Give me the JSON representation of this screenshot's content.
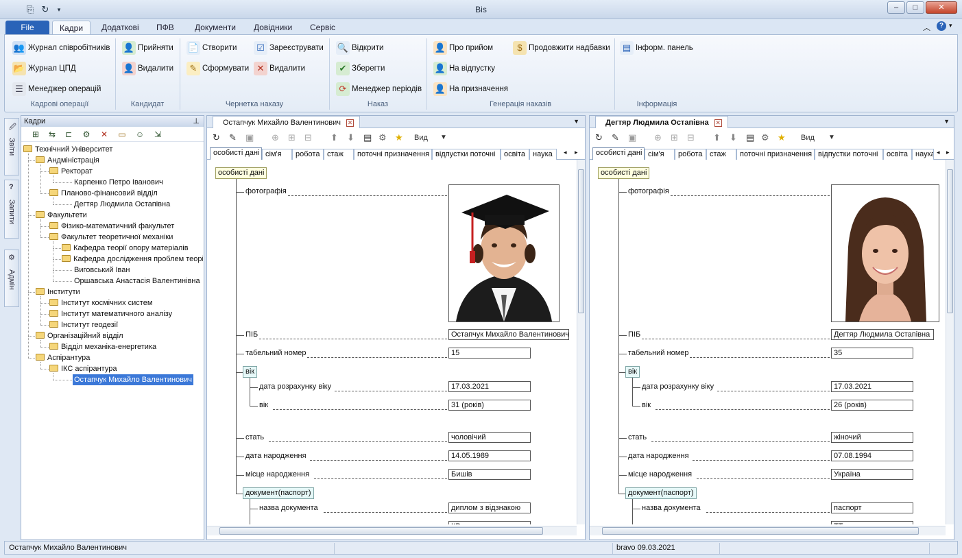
{
  "window": {
    "title": "Bis"
  },
  "menu": {
    "file": "File",
    "tabs": [
      "Кадри",
      "Додаткові",
      "ПФВ",
      "Документи",
      "Довідники",
      "Сервіс"
    ]
  },
  "ribbon": {
    "groups": [
      {
        "label": "Кадрові операції",
        "buttons": [
          "Журнал співробітників",
          "Журнал ЦПД",
          "Менеджер операцій"
        ]
      },
      {
        "label": "Кандидат",
        "buttons": [
          "Прийняти",
          "Видалити"
        ]
      },
      {
        "label": "Чернетка наказу",
        "buttons": [
          "Створити",
          "Сформувати",
          "Зареєструвати",
          "Видалити"
        ]
      },
      {
        "label": "Наказ",
        "buttons": [
          "Відкрити",
          "Зберегти",
          "Менеджер періодів"
        ]
      },
      {
        "label": "Генерація наказів",
        "buttons": [
          "Про прийом",
          "На відпустку",
          "На призначення",
          "Продовжити надбавки"
        ]
      },
      {
        "label": "Інформація",
        "buttons": [
          "Інформ. панель"
        ]
      }
    ]
  },
  "side_tabs": [
    "Звіти",
    "Запити",
    "Адмін"
  ],
  "tree": {
    "header": "Кадри",
    "nodes": [
      "Технічний Університет",
      "Андміністрація",
      "Ректорат",
      "Карпенко Петро Іванович",
      "Планово-фінансовий відділ",
      "Дегтяр Людмила Остапівна",
      "Факультети",
      "Фізико-математичний факультет",
      "Факультет теоретичної механіки",
      "Кафедра теорії опору матеріалів",
      "Кафедра дослідження проблем теорі",
      "Виговський Іван",
      "Оршавська Анастасія Валентинівна",
      "Інститути",
      "Інститут космічних систем",
      "Інститут математичного аналізу",
      "Інститут геодезії",
      "Організаційний відділ",
      "Відділ механіка-енергетика",
      "Аспірантура",
      "ІКС аспірантура",
      "Остапчук Михайло Валентинович"
    ]
  },
  "panel_toolbar": {
    "view": "Вид"
  },
  "subtabs": [
    "особисті дані",
    "сім'я",
    "робота",
    "стаж",
    "поточні призначення",
    "відпустки поточні",
    "освіта",
    "наука"
  ],
  "labels": {
    "section": "особисті дані",
    "photo": "фотографія",
    "pib": "ПІБ",
    "tab_number": "табельний номер",
    "age_group": "вік",
    "age_calc_date": "дата розрахунку віку",
    "age": "вік",
    "sex": "стать",
    "birth_date": "дата народження",
    "birth_place": "місце народження",
    "document_group": "документ(паспорт)",
    "document_name": "назва документа"
  },
  "panels": [
    {
      "tab_title": "Остапчук Михайло Валентинович",
      "pib": "Остапчук Михайло Валентинович",
      "tab_number": "15",
      "age_calc_date": "17.03.2021",
      "age": "31  (років)",
      "sex": "чоловічий",
      "birth_date": "14.05.1989",
      "birth_place": "Бишів",
      "document_name": "диплом з відзнакою",
      "next_value": "КВ"
    },
    {
      "tab_title": "Дегтяр Людмила Остапівна",
      "pib": "Дегтяр Людмила Остапівна",
      "tab_number": "35",
      "age_calc_date": "17.03.2021",
      "age": "26  (років)",
      "sex": "жіночий",
      "birth_date": "07.08.1994",
      "birth_place": "Україна",
      "document_name": "паспорт",
      "next_value": "ТТ"
    }
  ],
  "status": {
    "user": "Остапчук Михайло Валентинович",
    "login": "bravo 09.03.2021"
  },
  "colors": {
    "file_tab": "#2a63b8",
    "selection": "#3b78d8",
    "group_fill": "#e6f8f8",
    "section_fill": "#ffffe0"
  }
}
